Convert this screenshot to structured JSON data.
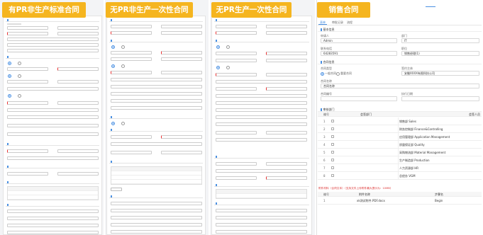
{
  "banners": [
    "有PR非生产标准合同",
    "无PR非生产一次性合同",
    "无PR生产一次性合同",
    "销售合同"
  ],
  "sales_contract": {
    "tabs": [
      "表单",
      "审批记录",
      "流程"
    ],
    "section_basic": "基本信息",
    "applicant_label": "申请人",
    "applicant_value": "Admin",
    "dept_label": "部门",
    "dept_value": "IT",
    "phone_label": "联系电话",
    "phone_value": "64283591",
    "position_label": "职位",
    "position_value": "销售经理(1)",
    "section_contract": "合同信息",
    "contract_type_label": "合同类型",
    "contract_type_options": [
      "一般合同",
      "重要合同"
    ],
    "contract_party_label": "签约主体",
    "contract_party_value": "安徽XXXX有限科技公司",
    "contract_name_label": "合同名称",
    "contract_name_value": "合同名称",
    "contract_no_label": "合同编号",
    "exec_date_label": "执行日期",
    "section_depts": "审核部门",
    "dept_table_headers": [
      "编号",
      "",
      "会签部门",
      "会签人员"
    ],
    "dept_rows": [
      {
        "n": "1",
        "name": "销售部 Sales"
      },
      {
        "n": "2",
        "name": "财务控制部 Finance&Controlling"
      },
      {
        "n": "3",
        "name": "应用管理部 Application Management"
      },
      {
        "n": "4",
        "name": "质量保证部 Quality"
      },
      {
        "n": "5",
        "name": "采购物流部 Material Management"
      },
      {
        "n": "6",
        "name": "生产制造部 Production"
      },
      {
        "n": "7",
        "name": "人力资源部 HR"
      },
      {
        "n": "8",
        "name": "总经办 VGM"
      }
    ],
    "attach_note": "附件材料（合同文本）（支持文件上传附件最大提示为：10MB）",
    "attach_headers": [
      "编号",
      "附件名称",
      "步骤名"
    ],
    "attach_rows": [
      {
        "n": "1",
        "name": "xk测试附件.PDF.docx",
        "step": "Begin"
      }
    ]
  },
  "colors": {
    "banner": "#f5b51f",
    "accent": "#4a90e2",
    "required": "#e33333"
  }
}
